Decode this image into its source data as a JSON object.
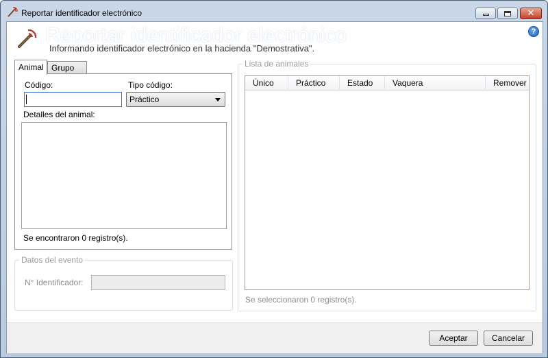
{
  "window": {
    "title": "Reportar identificador electrónico",
    "controls": {
      "minimize": "minimize-icon",
      "maximize": "maximize-icon",
      "close": "close-icon"
    }
  },
  "banner": {
    "title": "Reportar identificador electrónico",
    "subtitle": "Informando identificador electrónico en la hacienda \"Demostrativa\".",
    "help_label": "?"
  },
  "tabs": [
    {
      "label": "Animal",
      "active": true
    },
    {
      "label": "Grupo",
      "active": false
    }
  ],
  "animal_tab": {
    "codigo_label": "Código:",
    "codigo_value": "",
    "tipo_codigo_label": "Tipo código:",
    "tipo_codigo_value": "Práctico",
    "detalles_label": "Detalles del animal:",
    "registros_text": "Se encontraron 0 registro(s)."
  },
  "evento": {
    "legend": "Datos del evento",
    "identificador_label": "N° Identificador:",
    "identificador_value": ""
  },
  "lista": {
    "legend": "Lista de animales",
    "columns": [
      "Único",
      "Práctico",
      "Estado",
      "Vaquera",
      "Remover"
    ],
    "rows": [],
    "seleccionados_text": "Se seleccionaron 0 registro(s)."
  },
  "footer": {
    "accept_label": "Aceptar",
    "cancel_label": "Cancelar"
  },
  "colors": {
    "frame": "#c9d7e8",
    "accent": "#3a79c9",
    "disabled_text": "#9b9b9b"
  }
}
